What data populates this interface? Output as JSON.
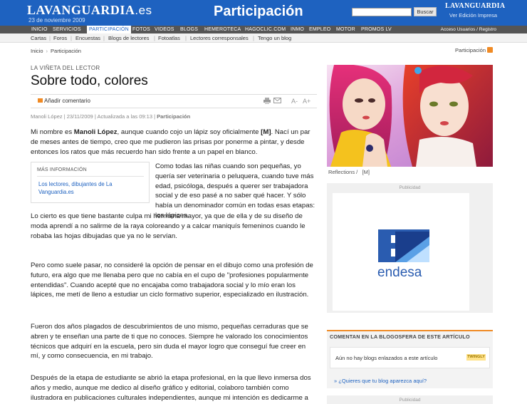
{
  "header": {
    "logo": "LAVANGUARDIA",
    "logo_suffix": ".es",
    "date": "23 de noviembre 2009",
    "section": "Participación",
    "search_placeholder": "",
    "search_button": "Buscar",
    "print_logo": "LAVANGUARDIA",
    "print_link": "Ver Edición Impresa"
  },
  "nav": {
    "items": [
      "INICIO",
      "SERVICIOS",
      "PARTICIPACIÓN",
      "FOTOS",
      "VIDEOS",
      "BLOGS",
      "HEMEROTECA",
      "HAGOCLIC.COM",
      "INMO",
      "EMPLEO",
      "MOTOR",
      "PROMOS LV"
    ],
    "active": "PARTICIPACIÓN",
    "right": "Acceso Usuarios / Registro"
  },
  "subnav": {
    "items": [
      "Cartas",
      "Foros",
      "Encuestas",
      "Blogs de lectores",
      "Fotoatlas",
      "Lectores corresponsales",
      "Tengo un blog"
    ]
  },
  "breadcrumb": [
    "Inicio",
    "Participación"
  ],
  "rss_label": "Participación",
  "article": {
    "kicker": "LA VIÑETA DEL LECTOR",
    "title": "Sobre todo, colores",
    "add_comment": "Añadir comentario",
    "font_smaller": "A-",
    "font_bigger": "A+",
    "byline_author": "Manoli López",
    "byline_date": "23/11/2009",
    "byline_updated": "Actualizada a las 09:13",
    "byline_section": "Participación",
    "p1_a": "Mi nombre es ",
    "p1_name": "Manoli López",
    "p1_b": ", aunque cuando cojo un lápiz soy oficialmente ",
    "p1_tag": "[M]",
    "p1_c": ". Nací un par de meses antes de tiempo, creo que me pudieron las prisas por ponerme a pintar, y desde entonces los ratos que más recuerdo han sido frente a un papel en blanco.",
    "p2_wrap": "Como todas las niñas cuando son pequeñas, yo quería ser veterinaria o peluquera, cuando tuve más edad, psicóloga, después a querer ser trabajadora social y de eso pasé a no saber qué hacer. Y sólo había un denominador común en todas esas etapas: los lápices.",
    "p2_full": "Lo cierto es que tiene bastante culpa mi hermana mayor, ya que de ella y de su diseño de moda aprendí a no salirme de la raya coloreando y a calcar maniquís femeninos cuando le robaba las hojas dibujadas que ya no le servían.",
    "p3": "Pero como suele pasar, no consideré la opción de pensar en el dibujo como una profesión de futuro, era algo que me llenaba pero que no cabía en el cupo de \"profesiones popularmente entendidas\". Cuando acepté que no encajaba como trabajadora social y lo mío eran los lápices, me metí de lleno a estudiar un ciclo formativo superior, especializado en ilustración.",
    "p4": "Fueron dos años plagados de descubrimientos de uno mismo, pequeñas cerraduras que se abren y te enseñan una parte de ti que no conoces. Siempre he valorado los conocimientos técnicos que adquirí en la escuela, pero sin duda el mayor logro que conseguí fue creer en mí, y como consecuencia, en mi trabajo.",
    "p5": "Después de la etapa de estudiante se abrió la etapa profesional, en la que llevo inmersa dos años y medio, aunque me dedico al diseño gráfico y editorial, colaboro también como ilustradora en publicaciones culturales independientes, aunque mi intención es dedicarme a"
  },
  "more_info": {
    "title": "MÁS INFORMACIÓN",
    "link": "Los lectores, dibujantes de La Vanguardia.es"
  },
  "photo": {
    "caption_title": "Reflections /",
    "caption_author": "[M]"
  },
  "ad": {
    "label": "Publicidad",
    "brand": "endesa"
  },
  "blogs": {
    "title": "COMENTAN EN LA BLOGOSFERA DE ESTE ARTÍCULO",
    "empty": "Aún no hay blogs enlazados a este artículo",
    "badge": "TWINGLY",
    "ask": "» ¿Quieres que tu blog aparezca aquí?"
  },
  "ad2": {
    "label": "Publicidad"
  },
  "colors": {
    "brand_blue": "#1e62c0",
    "nav_gray": "#555555",
    "accent_orange": "#f08a24"
  }
}
